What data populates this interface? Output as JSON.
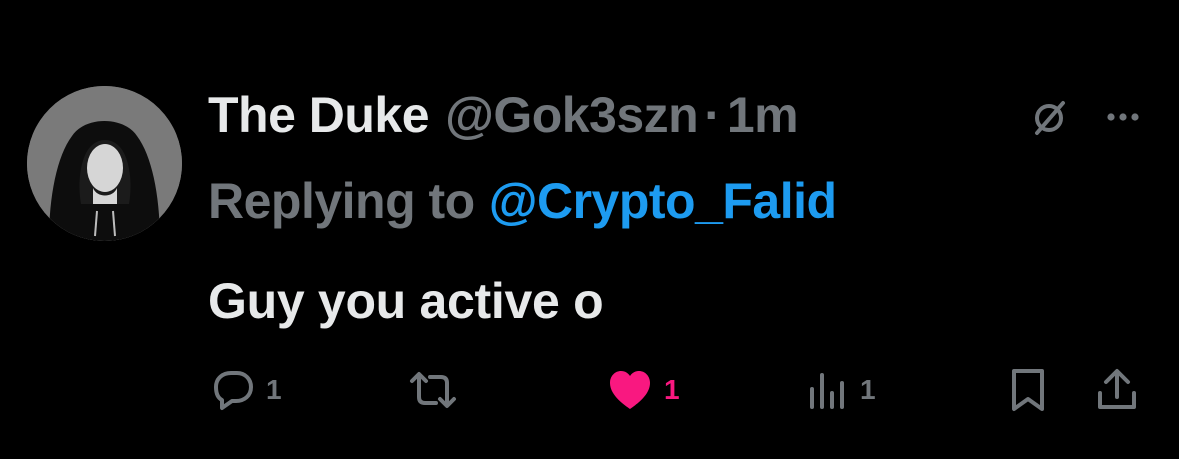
{
  "tweet": {
    "display_name": "The Duke",
    "handle": "@Gok3szn",
    "separator": "·",
    "time": "1m",
    "reply_prefix": "Replying to",
    "reply_to": "@Crypto_Falid",
    "text": "Guy you active o"
  },
  "actions": {
    "reply_count": "1",
    "like_count": "1",
    "views_count": "1",
    "liked": true
  },
  "icons": {
    "top": [
      "grok-icon",
      "more-icon"
    ],
    "actions": [
      "reply-icon",
      "retweet-icon",
      "heart-icon",
      "views-icon",
      "bookmark-icon",
      "share-icon"
    ]
  },
  "colors": {
    "background": "#000000",
    "primary_text": "#e7e9ea",
    "secondary_text": "#71767b",
    "link": "#1d9bf0",
    "like": "#f91880"
  }
}
